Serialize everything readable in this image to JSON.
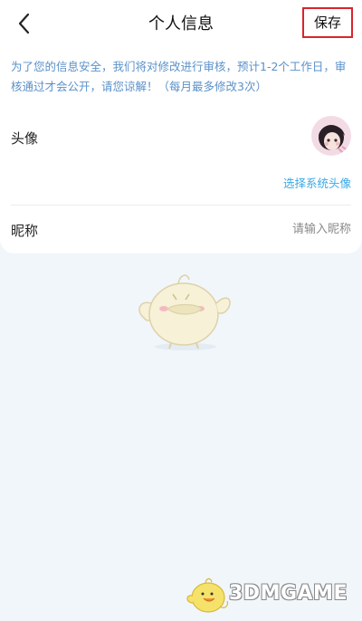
{
  "header": {
    "title": "个人信息",
    "save_label": "保存"
  },
  "notice": "为了您的信息安全，我们将对修改进行审核，预计1-2个工作日，审核通过才会公开，请您谅解！（每月最多修改3次）",
  "avatar_row": {
    "label": "头像",
    "choose_link": "选择系统头像"
  },
  "nickname_row": {
    "label": "昵称",
    "value": "",
    "placeholder": "请输入昵称"
  },
  "watermark": {
    "text": "3DMGAME"
  },
  "colors": {
    "background": "#f1f6fb",
    "card": "#ffffff",
    "notice_text": "#5b91c9",
    "link": "#3aa8e6",
    "save_border": "#d9242b"
  },
  "icons": [
    "back-arrow-icon",
    "mascot-bird-icon"
  ]
}
